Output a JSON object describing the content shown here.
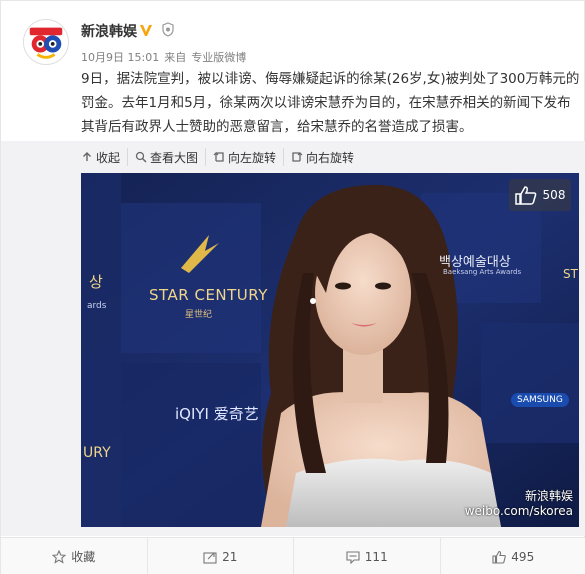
{
  "header": {
    "username": "新浪韩娱",
    "timestamp": "10月9日 15:01",
    "source_prefix": "来自",
    "source": "专业版微博"
  },
  "post": {
    "text": "9日，据法院宣判，被以诽谤、侮辱嫌疑起诉的徐某(26岁,女)被判处了300万韩元的罚金。去年1月和5月，徐某两次以诽谤宋慧乔为目的，在宋慧乔相关的新闻下发布其背后有政界人士赞助的恶意留言，给宋慧乔的名誉造成了损害。"
  },
  "image_toolbar": {
    "collapse": "收起",
    "view_large": "查看大图",
    "rotate_left": "向左旋转",
    "rotate_right": "向右旋转"
  },
  "photo": {
    "like_count": "508",
    "watermark_line1": "新浪韩娱",
    "watermark_line2": "weibo.com/skorea",
    "sponsor_logo": "STAR CENTURY",
    "sponsor_sub": "星世纪",
    "award_korean": "백상예술대상",
    "award_english": "Baeksang Arts Awards",
    "iqiyi": "爱奇艺",
    "samsung": "SAMSUNG",
    "left_korean": "상",
    "left_english": "ards",
    "left_bottom": "URY",
    "right_edge": "ST"
  },
  "actions": {
    "favorite": "收藏",
    "repost": "21",
    "comment": "111",
    "like": "495"
  },
  "colors": {
    "verified": "#f7a50e",
    "link_text": "#333333",
    "muted": "#808080",
    "backdrop": "#1d2a5e"
  },
  "icons": {
    "avatar": "sina-korea-logo",
    "verified": "v-badge-icon",
    "member": "vip-icon",
    "collapse": "arrow-up-icon",
    "view_large": "zoom-icon",
    "rotate_left": "rotate-left-icon",
    "rotate_right": "rotate-right-icon",
    "like_overlay": "thumbs-up-icon",
    "favorite": "star-icon",
    "repost": "repost-icon",
    "comment": "comment-icon",
    "like": "thumbs-up-icon"
  }
}
